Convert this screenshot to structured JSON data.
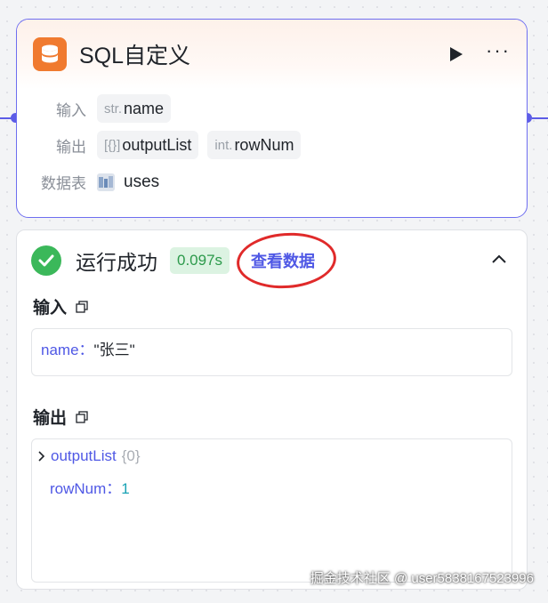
{
  "node": {
    "title": "SQL自定义",
    "icon": "database-icon",
    "accent": "#f07a2f",
    "input_label": "输入",
    "input_chip": {
      "type": "str.",
      "name": "name"
    },
    "output_label": "输出",
    "output_chips": [
      {
        "type": "[{}]",
        "name": "outputList"
      },
      {
        "type": "int.",
        "name": "rowNum"
      }
    ],
    "table_label": "数据表",
    "table_value": "uses"
  },
  "result": {
    "status": "运行成功",
    "status_color": "#3bb85a",
    "duration": "0.097s",
    "view_data_link": "查看数据",
    "input_title": "输入",
    "input_key": "name",
    "input_sep": "：",
    "input_value": "\"张三\"",
    "output_title": "输出",
    "output_list_key": "outputList",
    "output_list_count": "{0}",
    "output_rownum_key": "rowNum",
    "output_sep": "：",
    "output_rownum_value": "1"
  },
  "watermark": "掘金技术社区 @ user5838167523996"
}
